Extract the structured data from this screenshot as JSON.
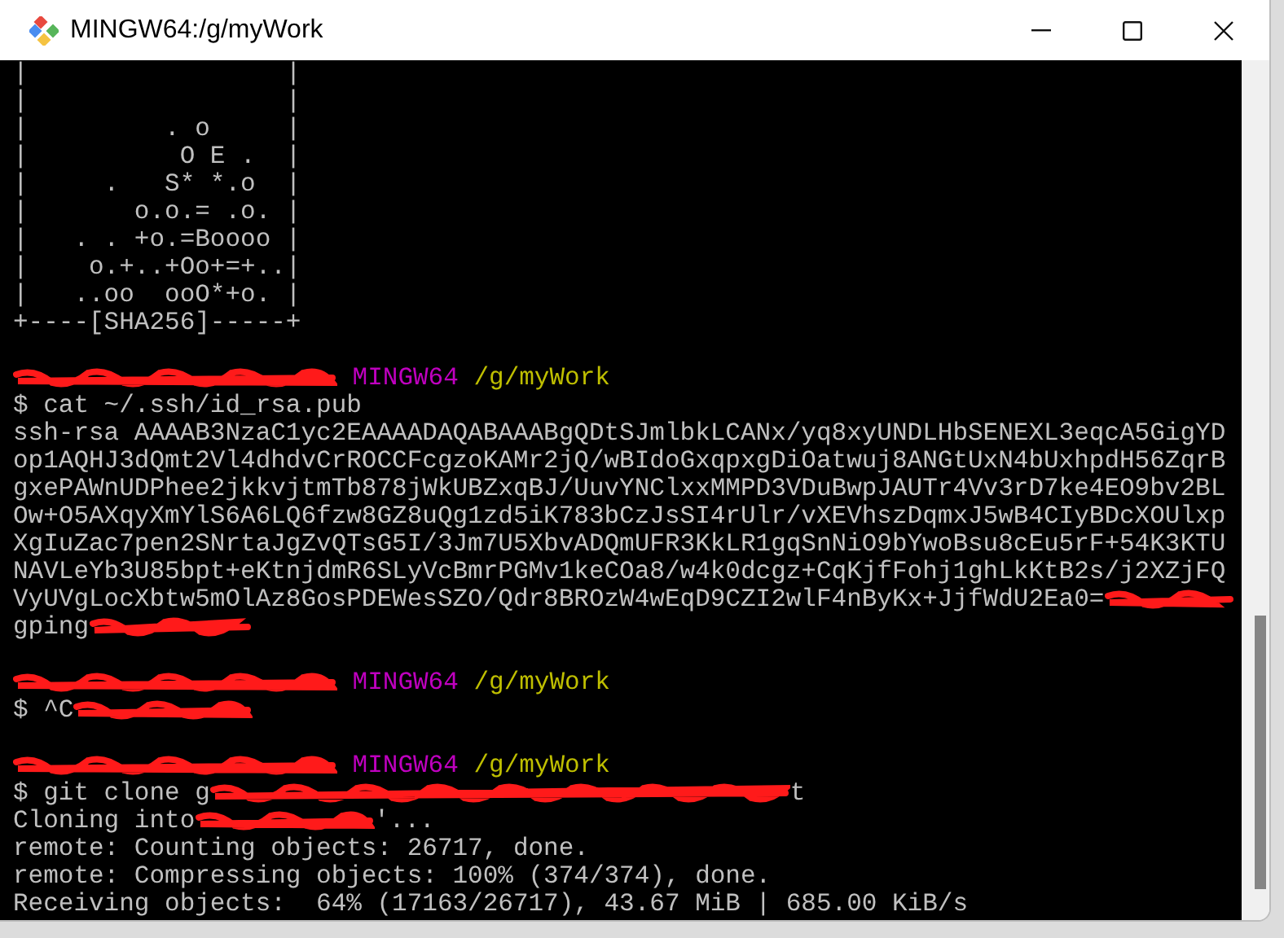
{
  "window": {
    "title": "MINGW64:/g/myWork"
  },
  "terminal": {
    "lines": [
      {
        "parts": [
          {
            "kind": "text",
            "text": "|                 |"
          }
        ]
      },
      {
        "parts": [
          {
            "kind": "text",
            "text": "|                 |"
          }
        ]
      },
      {
        "parts": [
          {
            "kind": "text",
            "text": "|         . o     |"
          }
        ]
      },
      {
        "parts": [
          {
            "kind": "text",
            "text": "|          O E .  |"
          }
        ]
      },
      {
        "parts": [
          {
            "kind": "text",
            "text": "|     .   S* *.o  |"
          }
        ]
      },
      {
        "parts": [
          {
            "kind": "text",
            "text": "|       o.o.= .o. |"
          }
        ]
      },
      {
        "parts": [
          {
            "kind": "text",
            "text": "|   . . +o.=Boooo |"
          }
        ]
      },
      {
        "parts": [
          {
            "kind": "text",
            "text": "|    o.+..+Oo+=+..|"
          }
        ]
      },
      {
        "parts": [
          {
            "kind": "text",
            "text": "|   ..oo  ooO*+o. |"
          }
        ]
      },
      {
        "parts": [
          {
            "kind": "text",
            "text": "+----[SHA256]-----+"
          }
        ]
      },
      {
        "kind": "blank"
      },
      {
        "parts": [
          {
            "kind": "redacted"
          },
          {
            "kind": "text",
            "text": " MINGW64",
            "color": "#bf00bf"
          },
          {
            "kind": "text",
            "text": " /g/myWork",
            "color": "#bfbf00"
          }
        ]
      },
      {
        "parts": [
          {
            "kind": "text",
            "text": "$ cat ~/.ssh/id_rsa.pub"
          }
        ]
      },
      {
        "parts": [
          {
            "kind": "text",
            "text": "ssh-rsa AAAAB3NzaC1yc2EAAAADAQABAAABgQDtSJmlbkLCANx/yq8xyUNDLHbSENEXL3eqcA5GigYD"
          }
        ]
      },
      {
        "parts": [
          {
            "kind": "text",
            "text": "op1AQHJ3dQmt2Vl4dhdvCrROCCFcgzoKAMr2jQ/wBIdoGxqpxgDiOatwuj8ANGtUxN4bUxhpdH56ZqrB"
          }
        ]
      },
      {
        "parts": [
          {
            "kind": "text",
            "text": "gxePAWnUDPhee2jkkvjtmTb878jWkUBZxqBJ/UuvYNClxxMMPD3VDuBwpJAUTr4Vv3rD7ke4EO9bv2BL"
          }
        ]
      },
      {
        "parts": [
          {
            "kind": "text",
            "text": "Ow+O5AXqyXmYlS6A6LQ6fzw8GZ8uQg1zd5iK783bCzJsSI4rUlr/vXEVhszDqmxJ5wB4CIyBDcXOUlxp"
          }
        ]
      },
      {
        "parts": [
          {
            "kind": "text",
            "text": "XgIuZac7pen2SNrtaJgZvQTsG5I/3Jm7U5XbvADQmUFR3KkLR1gqSnNiO9bYwoBsu8cEu5rF+54K3KTU"
          }
        ]
      },
      {
        "parts": [
          {
            "kind": "text",
            "text": "NAVLeYb3U85bpt+eKtnjdmR6SLyVcBmrPGMv1keCOa8/w4k0dcgz+CqKjfFohj1ghLkKtB2s/j2XZjFQ"
          }
        ]
      },
      {
        "parts": [
          {
            "kind": "text",
            "text": "VyUVgLocXbtw5mOlAz8GosPDEWesSZO/Qdr8BROzW4wEqD9CZI2wlF4nByKx+JjfWdU2Ea0="
          },
          {
            "kind": "redacted"
          }
        ]
      },
      {
        "parts": [
          {
            "kind": "text",
            "text": "gping"
          },
          {
            "kind": "redacted"
          }
        ]
      },
      {
        "kind": "blank"
      },
      {
        "parts": [
          {
            "kind": "redacted"
          },
          {
            "kind": "text",
            "text": " MINGW64",
            "color": "#bf00bf"
          },
          {
            "kind": "text",
            "text": " /g/myWork",
            "color": "#bfbf00"
          }
        ]
      },
      {
        "parts": [
          {
            "kind": "text",
            "text": "$ ^C"
          },
          {
            "kind": "redacted"
          }
        ]
      },
      {
        "kind": "blank"
      },
      {
        "parts": [
          {
            "kind": "redacted"
          },
          {
            "kind": "text",
            "text": " MINGW64",
            "color": "#bf00bf"
          },
          {
            "kind": "text",
            "text": " /g/myWork",
            "color": "#bfbf00"
          }
        ]
      },
      {
        "parts": [
          {
            "kind": "text",
            "text": "$ git clone g"
          },
          {
            "kind": "redacted"
          },
          {
            "kind": "text",
            "text": "t"
          }
        ]
      },
      {
        "parts": [
          {
            "kind": "text",
            "text": "Cloning into"
          },
          {
            "kind": "redacted"
          },
          {
            "kind": "text",
            "text": "'..."
          }
        ]
      },
      {
        "parts": [
          {
            "kind": "text",
            "text": "remote: Counting objects: 26717, done."
          }
        ]
      },
      {
        "parts": [
          {
            "kind": "text",
            "text": "remote: Compressing objects: 100% (374/374), done."
          }
        ]
      },
      {
        "parts": [
          {
            "kind": "text",
            "text": "Receiving objects:  64% (17163/26717), 43.67 MiB | 685.00 KiB/s"
          }
        ]
      }
    ]
  }
}
